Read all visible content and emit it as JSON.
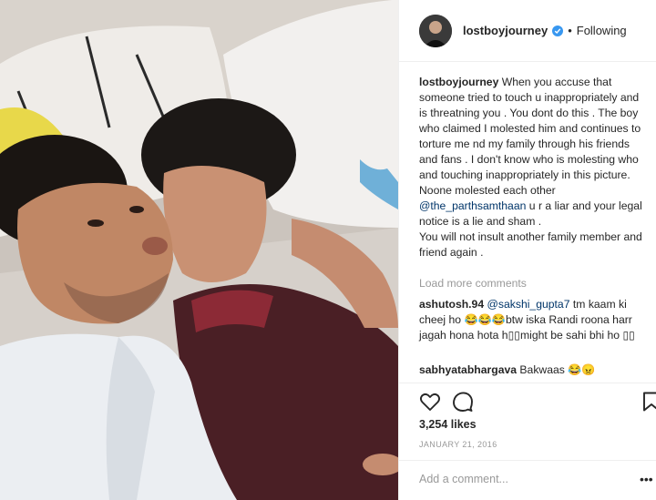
{
  "post": {
    "image_icon": "selfie-photo",
    "author": "lostboyjourney",
    "follow_state": "Following",
    "separator": "•",
    "caption": {
      "username": "lostboyjourney",
      "text_before_mention": "When you accuse that someone tried to touch u inappropriately and is threatning you . You dont do this . The boy who claimed I molested him and continues to torture me nd my family through his friends and fans . I don't know who is molesting who and touching inappropriately in this picture. Noone molested each other",
      "mention": "@the_parthsamthaan",
      "text_after_mention": "u r a liar and your legal notice is a lie and sham .",
      "line2": "You will not insult another family member and friend again ."
    },
    "load_more": "Load more comments",
    "comments": [
      {
        "username": "ashutosh.94",
        "mention": "@sakshi_gupta7",
        "text": "tm kaam ki cheej ho 😂😂😂btw iska Randi roona harr jagah hona hota h▯▯might be sahi bhi ho ▯▯"
      },
      {
        "username": "sabhyatabhargava",
        "mention": "",
        "text": "Bakwaas 😂😠"
      }
    ],
    "likes": "3,254 likes",
    "date": "JANUARY 21, 2016",
    "add_comment_placeholder": "Add a comment...",
    "more_options": "•••"
  },
  "icons": {
    "like": "heart-icon",
    "comment": "comment-icon",
    "save": "bookmark-icon",
    "verified": "verified-badge-icon"
  },
  "colors": {
    "verified_blue": "#3897f0",
    "link_blue": "#003569",
    "muted_gray": "#999999",
    "border": "#efefef"
  }
}
